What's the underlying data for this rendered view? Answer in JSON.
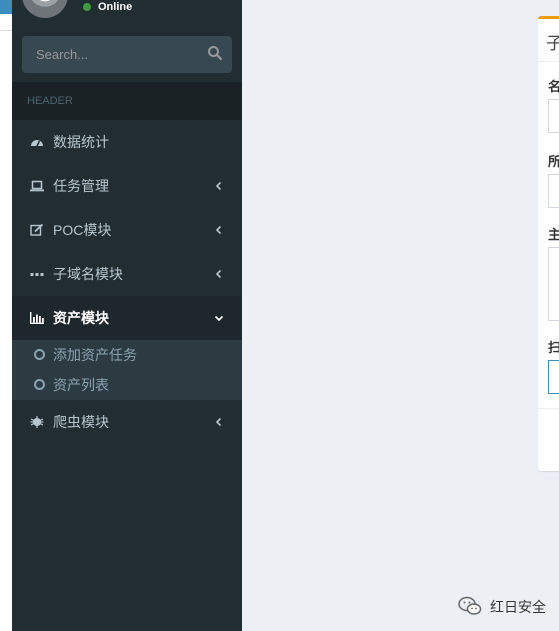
{
  "user": {
    "status": "Online",
    "status_color": "#3c9c3c"
  },
  "search": {
    "placeholder": "Search..."
  },
  "sidebar": {
    "header": "HEADER",
    "items": [
      {
        "label": "数据统计",
        "icon": "dashboard-icon",
        "has_children": false
      },
      {
        "label": "任务管理",
        "icon": "laptop-icon",
        "has_children": true
      },
      {
        "label": "POC模块",
        "icon": "edit-icon",
        "has_children": true
      },
      {
        "label": "子域名模块",
        "icon": "ellipsis-icon",
        "has_children": true
      },
      {
        "label": "资产模块",
        "icon": "bar-chart-icon",
        "has_children": true,
        "expanded": true,
        "children": [
          {
            "label": "添加资产任务"
          },
          {
            "label": "资产列表"
          }
        ]
      },
      {
        "label": "爬虫模块",
        "icon": "bug-icon",
        "has_children": true
      }
    ]
  },
  "panel": {
    "title": "子",
    "labels": [
      "名",
      "所",
      "主",
      "扫"
    ],
    "accent": "#f39c12"
  },
  "watermark": {
    "text": "红日安全"
  },
  "colors": {
    "sidebar_bg": "#222d32",
    "content_bg": "#ecf0f5",
    "accent": "#3c8dbc"
  }
}
